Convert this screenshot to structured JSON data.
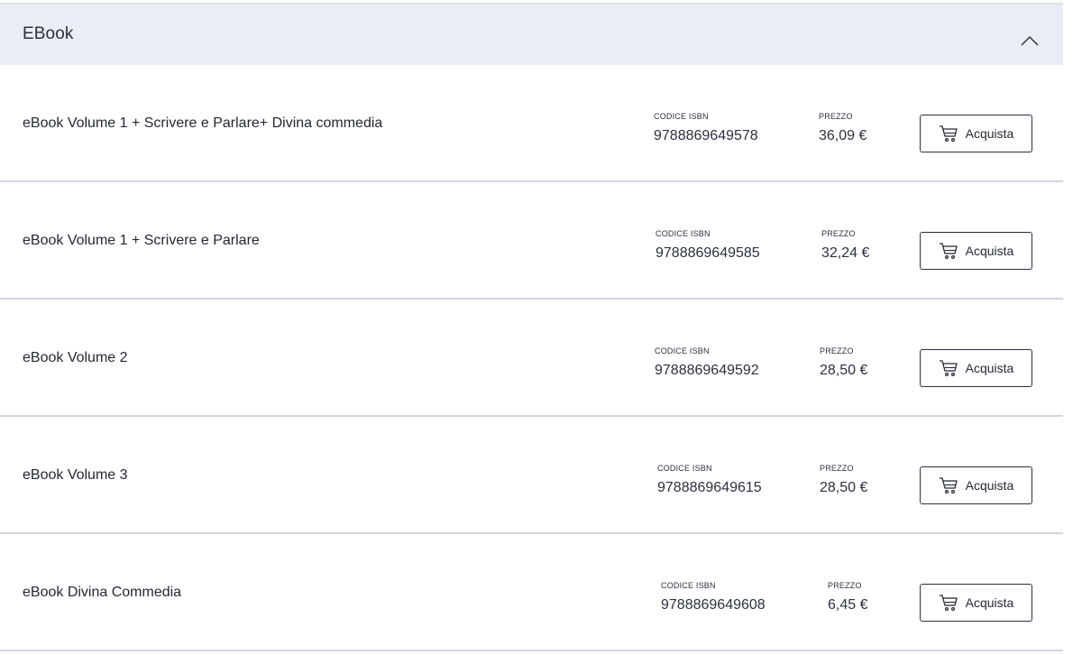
{
  "section": {
    "title": "EBook",
    "toggle_icon": "chevron-up-icon"
  },
  "labels": {
    "isbn": "CODICE ISBN",
    "price": "PREZZO",
    "buy": "Acquista",
    "buy_icon": "cart-icon"
  },
  "products": [
    {
      "title": "eBook Volume 1 + Scrivere e Parlare+ Divina commedia",
      "isbn": "9788869649578",
      "price": "36,09 €"
    },
    {
      "title": "eBook Volume 1 + Scrivere e Parlare",
      "isbn": "9788869649585",
      "price": "32,24 €"
    },
    {
      "title": "eBook Volume 2",
      "isbn": "9788869649592",
      "price": "28,50 €"
    },
    {
      "title": "eBook Volume 3",
      "isbn": "9788869649615",
      "price": "28,50 €"
    },
    {
      "title": "eBook Divina Commedia",
      "isbn": "9788869649608",
      "price": "6,45 €"
    }
  ],
  "colors": {
    "header_bg": "#e9edf5",
    "divider": "#cfd6e0",
    "text": "#232834"
  }
}
